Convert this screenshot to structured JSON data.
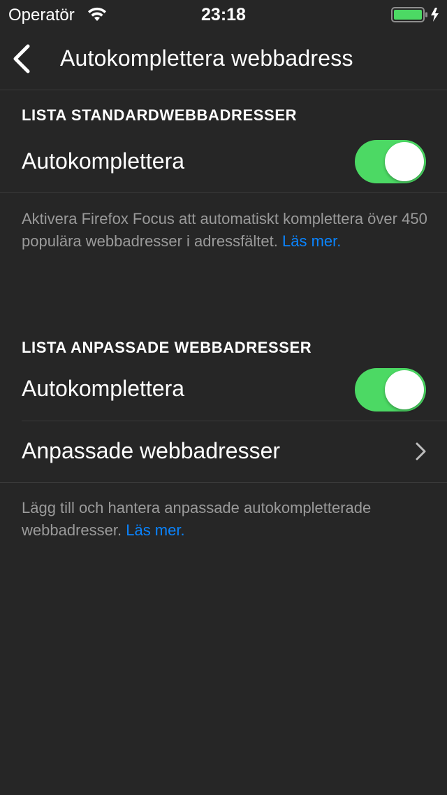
{
  "status_bar": {
    "carrier": "Operatör",
    "time": "23:18"
  },
  "nav": {
    "title": "Autokomplettera webbadress",
    "back_icon": "chevron-left-icon"
  },
  "sections": {
    "standard": {
      "header": "LISTA STANDARDWEBBADRESSER",
      "toggle_label": "Autokomplettera",
      "toggle_on": true,
      "footer_text": "Aktivera Firefox Focus att automatiskt komplettera över 450 populära webbadresser i adressfältet.",
      "footer_link": "Läs mer."
    },
    "custom": {
      "header": "LISTA ANPASSADE WEBBADRESSER",
      "toggle_label": "Autokomplettera",
      "toggle_on": true,
      "nav_row_label": "Anpassade webbadresser",
      "footer_text": "Lägg till och hantera anpassade autokompletterade webbadresser.",
      "footer_link": "Läs mer."
    }
  },
  "colors": {
    "background": "#262626",
    "toggle_on": "#4cd964",
    "link": "#0a84ff",
    "secondary_text": "#9a9a9a",
    "battery": "#4cd964"
  }
}
